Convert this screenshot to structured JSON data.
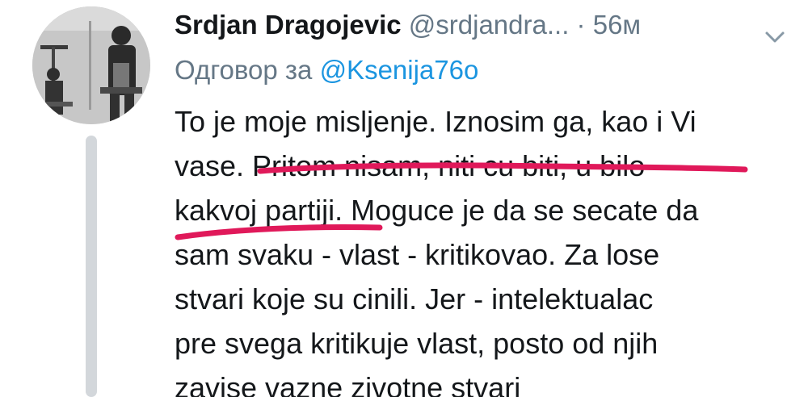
{
  "tweet": {
    "author_name": "Srdjan Dragojevic",
    "author_handle": "@srdjandra...",
    "separator": "·",
    "timestamp": "56м",
    "reply_prefix": "Одговор за",
    "reply_handle": "@Ksenija76o",
    "body_lines": [
      "To je moje misljenje. Iznosim ga, kao i Vi",
      "vase. Pritom nisam, niti cu biti, u bilo",
      "kakvoj partiji. Moguce je da se secate da",
      "sam svaku - vlast - kritikovao. Za lose",
      "stvari koje su cinili. Jer - intelektualac",
      "pre svega kritikuje vlast, posto od njih",
      "zavise vazne zivotne stvari"
    ],
    "caret_icon": "chevron-down-icon",
    "avatar_icon": "avatar-photo",
    "highlight_color": "#e0195a"
  }
}
